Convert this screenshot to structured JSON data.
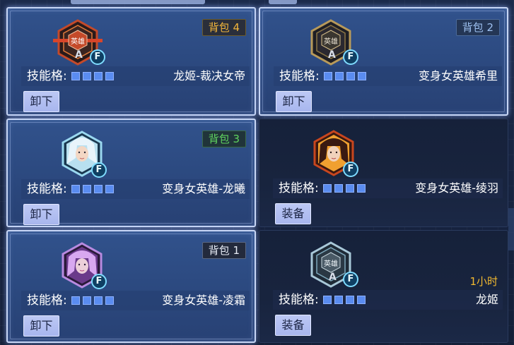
{
  "cards": [
    {
      "badge": "背包 4",
      "badge_style": "gold",
      "skill_label": "技能格:",
      "slot_count": 4,
      "hero_name": "龙姬-裁决女帝",
      "button_label": "卸下",
      "portrait": "hero-emblem",
      "emblem_text": "英雄",
      "rank": "A",
      "f_badge": "F",
      "equipped": true,
      "accent": "#c44a2a"
    },
    {
      "badge": "背包 2",
      "badge_style": "blue",
      "skill_label": "技能格:",
      "slot_count": 4,
      "hero_name": "变身女英雄希里",
      "button_label": "卸下",
      "portrait": "hero-emblem",
      "emblem_text": "英雄",
      "rank": "A",
      "f_badge": "F",
      "equipped": true,
      "accent": "#6b5a2a"
    },
    {
      "badge": "背包 3",
      "badge_style": "green",
      "skill_label": "技能格:",
      "slot_count": 4,
      "hero_name": "变身女英雄-龙曦",
      "button_label": "卸下",
      "portrait": "hero-portrait",
      "f_badge": "F",
      "equipped": true,
      "accent": "#5bb8d8"
    },
    {
      "badge": "",
      "skill_label": "技能格:",
      "slot_count": 4,
      "hero_name": "变身女英雄-绫羽",
      "button_label": "装备",
      "portrait": "hero-portrait",
      "f_badge": "F",
      "equipped": false,
      "accent": "#d8452a"
    },
    {
      "badge": "背包 1",
      "badge_style": "white",
      "skill_label": "技能格:",
      "slot_count": 4,
      "hero_name": "变身女英雄-凌霜",
      "button_label": "卸下",
      "portrait": "hero-portrait",
      "f_badge": "F",
      "equipped": true,
      "accent": "#a86ad8"
    },
    {
      "badge": "",
      "timer": "1小时",
      "skill_label": "技能格:",
      "slot_count": 4,
      "hero_name": "龙姬",
      "button_label": "装备",
      "portrait": "hero-emblem",
      "emblem_text": "英雄",
      "rank": "A",
      "f_badge": "F",
      "equipped": false,
      "accent": "#8ab4c8"
    }
  ]
}
